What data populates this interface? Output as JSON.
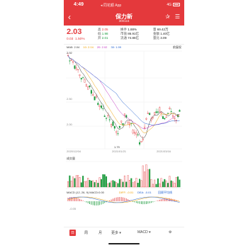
{
  "status": {
    "time": "4:49",
    "app": "◂ 同花顺 App",
    "network": "4G"
  },
  "header": {
    "back": "‹",
    "name": "保力新",
    "code": "300116",
    "icon_a": "✰",
    "icon_b": "☰"
  },
  "quote": {
    "price": "2.03",
    "change": "0.03",
    "change_pct": "1.50%",
    "col1": [
      {
        "k": "高",
        "v": "2.05"
      },
      {
        "k": "低",
        "v": "1.98"
      },
      {
        "k": "开",
        "v": "2.01"
      }
    ],
    "col2": [
      {
        "k": "换手",
        "v": "1.88%"
      },
      {
        "k": "市值",
        "v": "86.91亿"
      },
      {
        "k": "流通",
        "v": "74.85亿"
      }
    ],
    "col3": [
      {
        "k": "量",
        "v": "69.42万"
      },
      {
        "k": "金额",
        "v": "1.40亿"
      },
      {
        "k": "量比",
        "v": "3.09"
      }
    ]
  },
  "ma_legend": {
    "ma5": "MA5: 2.04",
    "ma10": "10: 2.04",
    "ma20": "20: 2.02",
    "ma30": "30: 1.99",
    "right": "前复权"
  },
  "chart_labels": {
    "high": "2.92",
    "low": "1.79",
    "ytick_top": "2.50",
    "ytick_bottom": "2.00",
    "date_left": "2020/12/04",
    "date_mid": "2021/01/21",
    "date_right": "2021/03/16",
    "volume_title": "成交量",
    "macd_title": "MACD (12, 26, 9) MACD:0.00",
    "dif": "DIFF: -0.01",
    "dea": "DEA: -0.01",
    "macd_right": "回顾平均线",
    "macd_tick": "-0.05"
  },
  "colors": {
    "up": "#e4393c",
    "down": "#1a9a3c",
    "ma5": "#333333",
    "ma10": "#f0a000",
    "ma20": "#c030c0",
    "ma30": "#2060d0",
    "brand": "#e4393c"
  },
  "tabs": [
    "日",
    "周",
    "月",
    "更多 ▾",
    "MACD ▾",
    "⚙"
  ]
}
